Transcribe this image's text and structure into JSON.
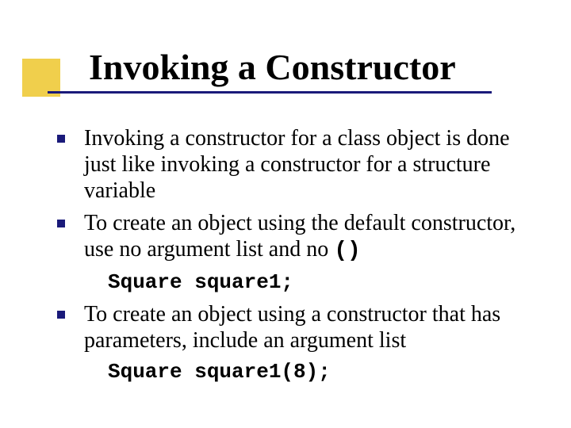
{
  "title": "Invoking a Constructor",
  "bullets": [
    {
      "text": "Invoking a constructor for a class object is done just like invoking a constructor for a structure variable"
    },
    {
      "text_prefix": "To create an object using the default constructor, use no argument list and no ",
      "code_inline": "()",
      "code_after": "Square square1;"
    },
    {
      "text": "To create an object using a constructor that has parameters, include an argument list",
      "code_after": "Square square1(8);"
    }
  ]
}
